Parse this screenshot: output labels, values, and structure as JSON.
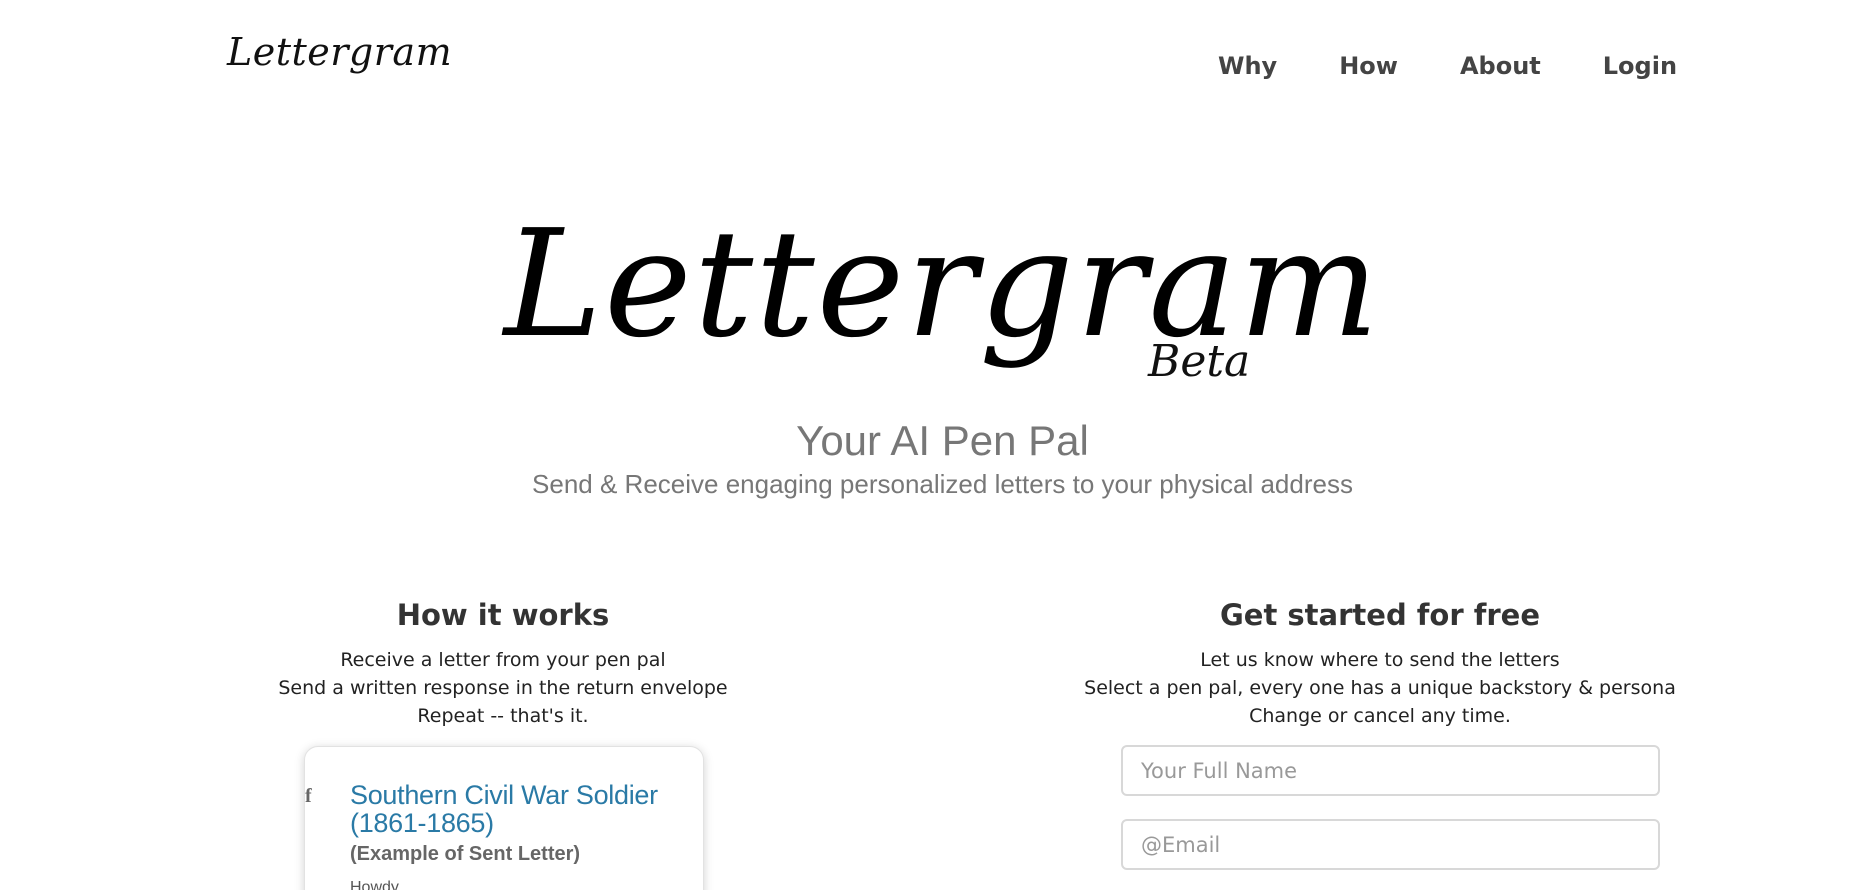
{
  "nav": {
    "logo": "Lettergram",
    "links": [
      "Why",
      "How",
      "About",
      "Login"
    ]
  },
  "hero": {
    "logo": "Lettergram",
    "badge": "Beta",
    "tagline": "Your AI Pen Pal",
    "subtagline": "Send & Receive engaging personalized letters to your physical address"
  },
  "how_it_works": {
    "heading": "How it works",
    "lines": [
      "Receive a letter from your pen pal",
      "Send a written response in the return envelope",
      "Repeat -- that's it."
    ],
    "card": {
      "marker": "f",
      "title": "Southern Civil War Soldier (1861-1865)",
      "subtitle": "(Example of Sent Letter)",
      "body": "Howdy,"
    }
  },
  "get_started": {
    "heading": "Get started for free",
    "lines": [
      "Let us know where to send the letters",
      "Select a pen pal, every one has a unique backstory & persona",
      "Change or cancel any time."
    ],
    "name_placeholder": "Your Full Name",
    "email_placeholder": "@Email",
    "name_value": "",
    "email_value": ""
  },
  "colors": {
    "card_title": "#2a7aa6",
    "muted_text": "#777777",
    "nav_text": "#444444"
  }
}
